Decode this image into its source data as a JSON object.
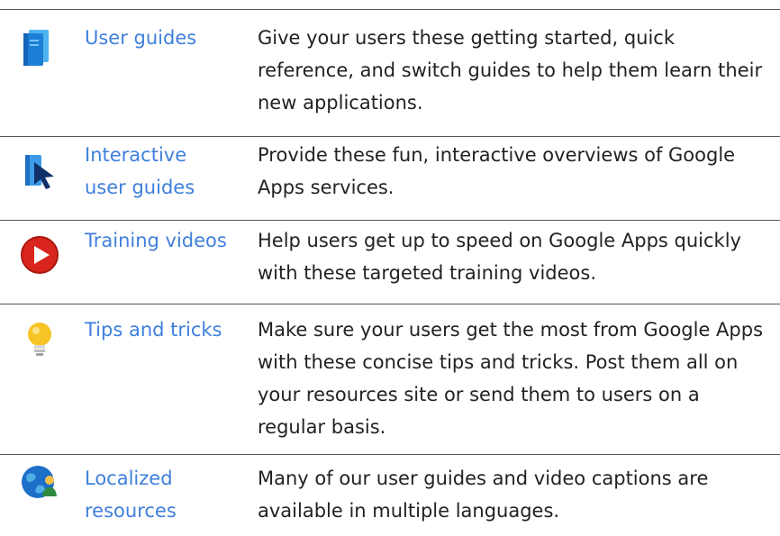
{
  "rows": [
    {
      "icon": "user-guide-book-icon",
      "link": "User guides",
      "description": "Give your users these getting started, quick reference, and switch guides to help them learn their new applications."
    },
    {
      "icon": "interactive-guide-cursor-icon",
      "link": "Interactive user guides",
      "description": "Provide these fun, interactive overviews of Google Apps services."
    },
    {
      "icon": "play-video-icon",
      "link": "Training videos",
      "description": "Help users get up to speed on Google Apps quickly with these targeted training videos."
    },
    {
      "icon": "lightbulb-icon",
      "link": "Tips and tricks",
      "description": "Make sure your users get the most from Google Apps with these concise tips and tricks. Post them all on your resources site or send them to users on a regular basis."
    },
    {
      "icon": "globe-person-icon",
      "link": "Localized resources",
      "description": "Many of our user guides and video captions are available in multiple languages."
    }
  ],
  "colors": {
    "link": "#3f7fdc",
    "text": "#222222",
    "rule": "#555555"
  }
}
